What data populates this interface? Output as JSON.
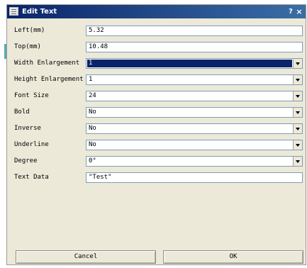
{
  "window": {
    "title": "Edit Text",
    "help": "?",
    "close": "×"
  },
  "fields": {
    "left_label": "Left(mm)",
    "left_value": "5.32",
    "top_label": "Top(mm)",
    "top_value": "10.48",
    "width_enl_label": "Width Enlargement",
    "width_enl_value": "1",
    "height_enl_label": "Height Enlargement",
    "height_enl_value": "1",
    "font_size_label": "Font Size",
    "font_size_value": "24",
    "bold_label": "Bold",
    "bold_value": "No",
    "inverse_label": "Inverse",
    "inverse_value": "No",
    "underline_label": "Underline",
    "underline_value": "No",
    "degree_label": "Degree",
    "degree_value": "0°",
    "text_data_label": "Text Data",
    "text_data_value": "\"Test\""
  },
  "buttons": {
    "cancel": "Cancel",
    "ok": "OK"
  },
  "colors": {
    "titlebar": "#0a246a",
    "dialog_bg": "#ece9d8",
    "selection": "#0a246a"
  }
}
